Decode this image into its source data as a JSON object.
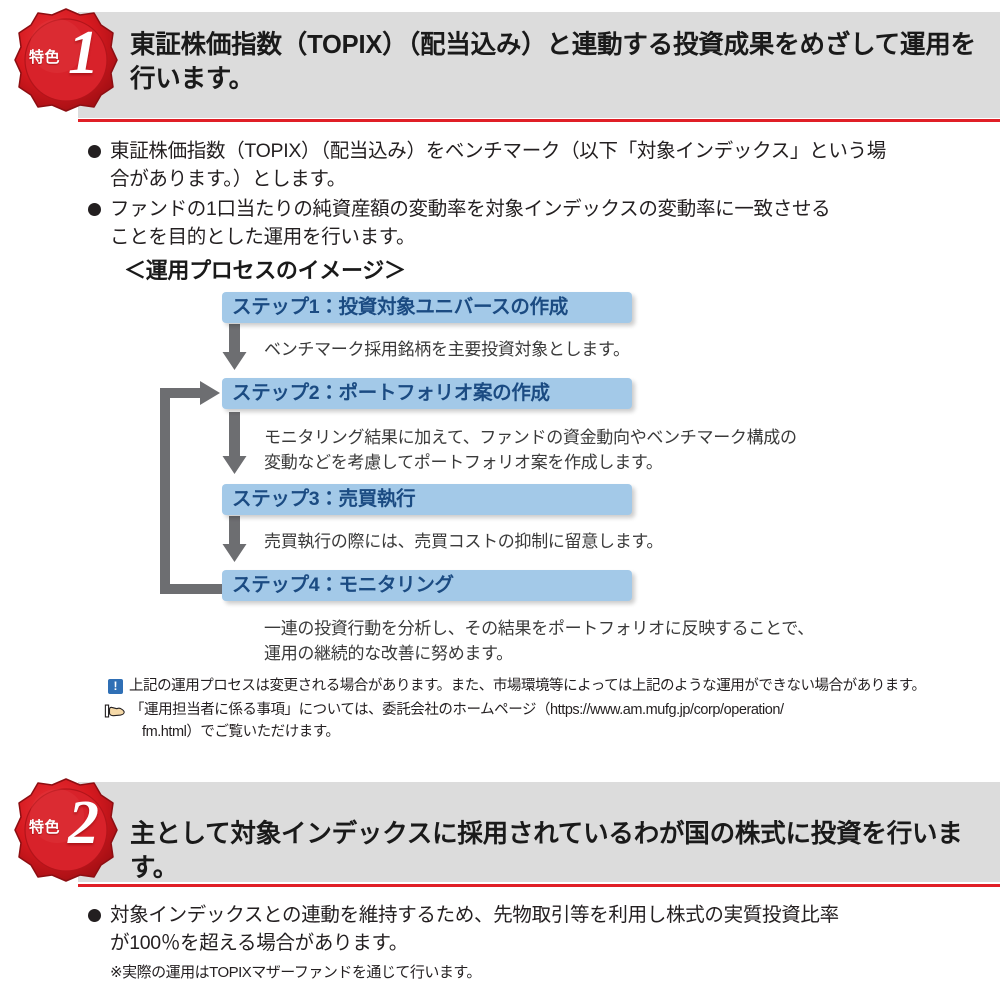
{
  "document": {
    "type": "fund-prospectus-features-page",
    "language": "ja"
  },
  "colors": {
    "seal_red": "#d6191f",
    "header_gray": "#dcdcdc",
    "accent_red": "#e01f26",
    "step_blue": "#a3c9e8",
    "step_text_navy": "#1b4b82",
    "arrow_gray": "#6d6e71",
    "alert_blue": "#2f6fb5"
  },
  "features": [
    {
      "seal": {
        "label": "特色",
        "number": "1",
        "icon": "wax-seal-icon"
      },
      "headline_line1": "東証株価指数（TOPIX）（配当込み）と連動する投資成果をめざして運用を",
      "headline_line2": "行います。",
      "bullets": [
        {
          "line1": "東証株価指数（TOPIX）（配当込み）をベンチマーク（以下「対象インデックス」という場",
          "line2": "合があります。）とします。"
        },
        {
          "line1": "ファンドの1口当たりの純資産額の変動率を対象インデックスの変動率に一致させる",
          "line2": "ことを目的とした運用を行います。"
        }
      ],
      "subtitle": "＜運用プロセスのイメージ＞",
      "flow": {
        "steps": [
          {
            "label": "ステップ1：投資対象ユニバースの作成",
            "description_lines": [
              "ベンチマーク採用銘柄を主要投資対象とします。"
            ]
          },
          {
            "label": "ステップ2：ポートフォリオ案の作成",
            "description_lines": [
              "モニタリング結果に加えて、ファンドの資金動向やベンチマーク構成の",
              "変動などを考慮してポートフォリオ案を作成します。"
            ]
          },
          {
            "label": "ステップ3：売買執行",
            "description_lines": [
              "売買執行の際には、売買コストの抑制に留意します。"
            ]
          },
          {
            "label": "ステップ4：モニタリング",
            "description_lines": [
              "一連の投資行動を分析し、その結果をポートフォリオに反映することで、",
              "運用の継続的な改善に努めます。"
            ]
          }
        ],
        "feedback_loop": "ステップ4からステップ2へ戻るフィードバックループ"
      },
      "footnotes": [
        {
          "icon": "alert-icon",
          "icon_glyph": "!",
          "lines": [
            "上記の運用プロセスは変更される場合があります。また、市場環境等によっては上記のような運用ができない場合があります。"
          ]
        },
        {
          "icon": "pointing-hand-icon",
          "lines": [
            "「運用担当者に係る事項」については、委託会社のホームページ（https://www.am.mufg.jp/corp/operation/",
            "fm.html）でご覧いただけます。"
          ]
        }
      ]
    },
    {
      "seal": {
        "label": "特色",
        "number": "2",
        "icon": "wax-seal-icon"
      },
      "headline_line1": "主として対象インデックスに採用されているわが国の株式に投資を行います。",
      "headline_line2": "",
      "bullets": [
        {
          "line1": "対象インデックスとの連動を維持するため、先物取引等を利用し株式の実質投資比率",
          "line2": "が100％を超える場合があります。"
        }
      ],
      "note": "※実際の運用はTOPIXマザーファンドを通じて行います。"
    }
  ]
}
